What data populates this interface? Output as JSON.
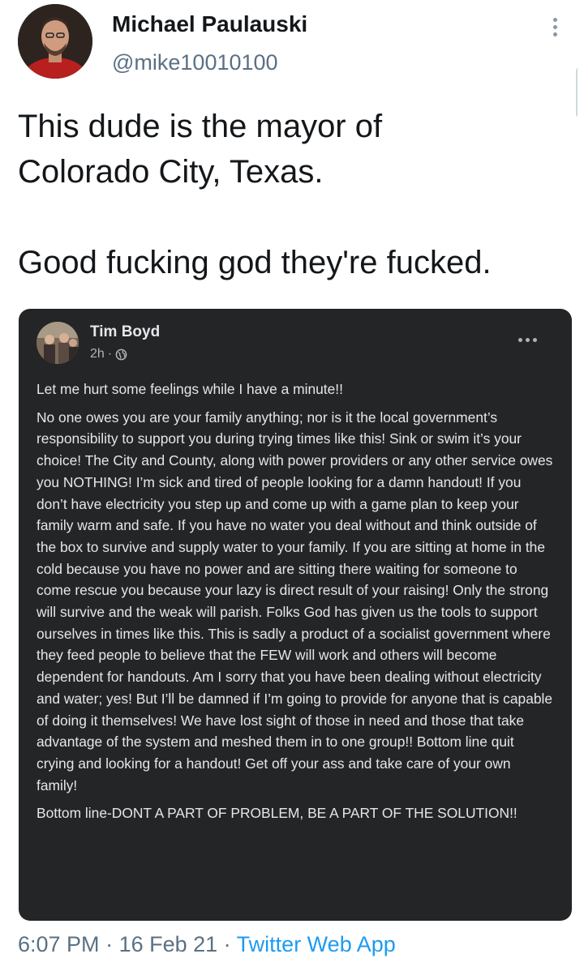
{
  "tweet": {
    "author_name": "Michael Paulauski",
    "handle": "@mike10010100",
    "text": "This dude is the mayor of\nColorado City, Texas.\n\nGood fucking god they're fucked.",
    "time": "6:07 PM",
    "separator1": " · ",
    "date": "16 Feb 21",
    "separator2": " · ",
    "app": "Twitter Web App",
    "menu_icon": "more-vertical-icon",
    "link_color": "#1d9bf0"
  },
  "facebook_post": {
    "author_name": "Tim Boyd",
    "time": "2h",
    "time_separator": " · ",
    "audience_icon": "globe-icon",
    "menu_icon": "more-horizontal-icon",
    "background": "#242526",
    "paragraphs": [
      "Let me hurt some feelings while I have a minute!!",
      "No one owes you are your family anything; nor is it the local government’s responsibility to support you during trying times like this! Sink or swim it’s your choice! The City and County, along with power providers or any other service owes you NOTHING! I’m sick and tired of people looking for a damn handout! If you don’t have electricity you step up and come up with a game plan to keep your family warm and safe. If you have no water you deal without and think outside of the box to survive and supply water to your family. If you are sitting at home in the cold because you have no power and are sitting there waiting for someone to come rescue you because your lazy is direct result of your raising! Only the strong will survive and the weak will parish. Folks God has given us the tools to support ourselves in times like this. This is sadly a product of a socialist government where they feed people to believe that the FEW will work and others will become dependent for handouts. Am I sorry that you have been dealing without electricity and water; yes! But I’ll be damned if I’m going to provide for anyone that is capable of doing it themselves! We have lost sight of those in need and those that take advantage of the system and meshed them in to one group!! Bottom line quit crying and looking for a handout! Get off your ass and take care of your own family!",
      "Bottom line-DONT A PART OF PROBLEM, BE A PART OF THE SOLUTION!!"
    ]
  }
}
